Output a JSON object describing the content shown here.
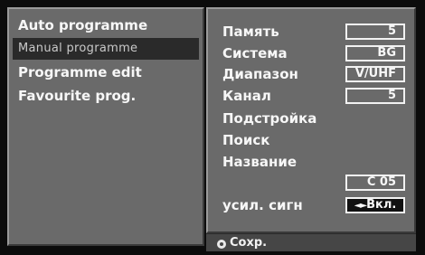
{
  "menu": {
    "items": [
      {
        "label": "Auto programme"
      },
      {
        "label": "Manual programme"
      },
      {
        "label": "Programme edit"
      },
      {
        "label": "Favourite prog."
      }
    ]
  },
  "settings": {
    "memory_label": "Память",
    "memory_value": "5",
    "system_label": "Система",
    "system_value": "BG",
    "band_label": "Диапазон",
    "band_value": "V/UHF",
    "channel_label": "Канал",
    "channel_value": "5",
    "fine_label": "Подстройка",
    "search_label": "Поиск",
    "name_label": "Название",
    "name_value": "C 05",
    "booster_label": "усил. сигн",
    "booster_arrows": "◄►",
    "booster_value": "Вкл."
  },
  "footer": {
    "save_label": "Сохр."
  }
}
